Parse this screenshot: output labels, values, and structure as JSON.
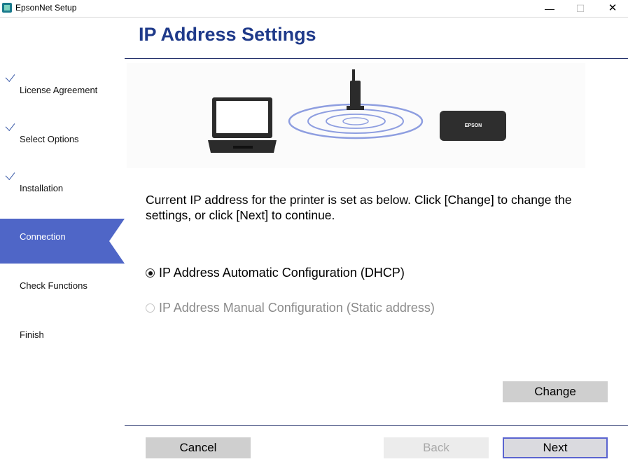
{
  "window": {
    "title": "EpsonNet Setup",
    "minimize": "—",
    "maximize": "☐",
    "close": "✕"
  },
  "sidebar": {
    "steps": [
      {
        "label": "License Agreement",
        "done": true
      },
      {
        "label": "Select Options",
        "done": true
      },
      {
        "label": "Installation",
        "done": true
      },
      {
        "label": "Connection",
        "active": true
      },
      {
        "label": "Check Functions"
      },
      {
        "label": "Finish"
      }
    ]
  },
  "header": {
    "title": "IP Address Settings"
  },
  "illustration": {
    "printer_brand": "EPSON"
  },
  "body": {
    "description": "Current IP address for the printer is set as below. Click [Change] to change the settings, or click [Next] to continue.",
    "options": [
      {
        "label": "IP Address Automatic Configuration (DHCP)",
        "selected": true,
        "enabled": true
      },
      {
        "label": "IP Address Manual Configuration (Static address)",
        "selected": false,
        "enabled": false
      }
    ],
    "change_label": "Change"
  },
  "footer": {
    "cancel_label": "Cancel",
    "back_label": "Back",
    "next_label": "Next"
  },
  "colors": {
    "accent": "#4f66c7",
    "title": "#1f3a8a",
    "focus_border": "#5a64d0"
  }
}
